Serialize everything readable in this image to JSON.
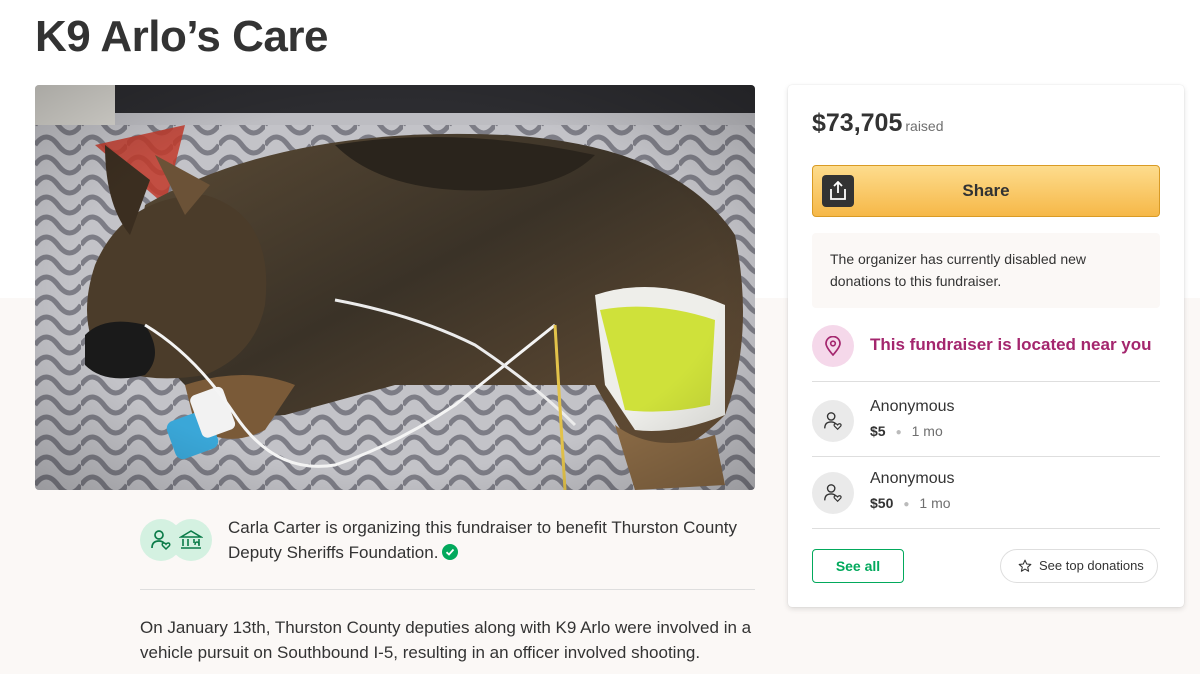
{
  "page_title": "K9 Arlo’s Care",
  "organizer": {
    "text": "Carla Carter is organizing this fundraiser to benefit Thurston County Deputy Sheriffs Foundation."
  },
  "story": "On January 13th, Thurston County deputies along with K9 Arlo were involved in a vehicle pursuit on Southbound  I-5, resulting in an officer involved shooting.",
  "card": {
    "raised_amount": "$73,705",
    "raised_label": "raised",
    "share_label": "Share",
    "notice": "The organizer has currently disabled new donations to this fundraiser.",
    "location_text": "This fundraiser is located near you",
    "donations": [
      {
        "name": "Anonymous",
        "amount": "$5",
        "time": "1 mo"
      },
      {
        "name": "Anonymous",
        "amount": "$50",
        "time": "1 mo"
      }
    ],
    "see_all_label": "See all",
    "see_top_label": "See top donations"
  },
  "colors": {
    "brand_green": "#02a95c",
    "share_yellow": "#f6b848",
    "location_magenta": "#a4266e"
  }
}
